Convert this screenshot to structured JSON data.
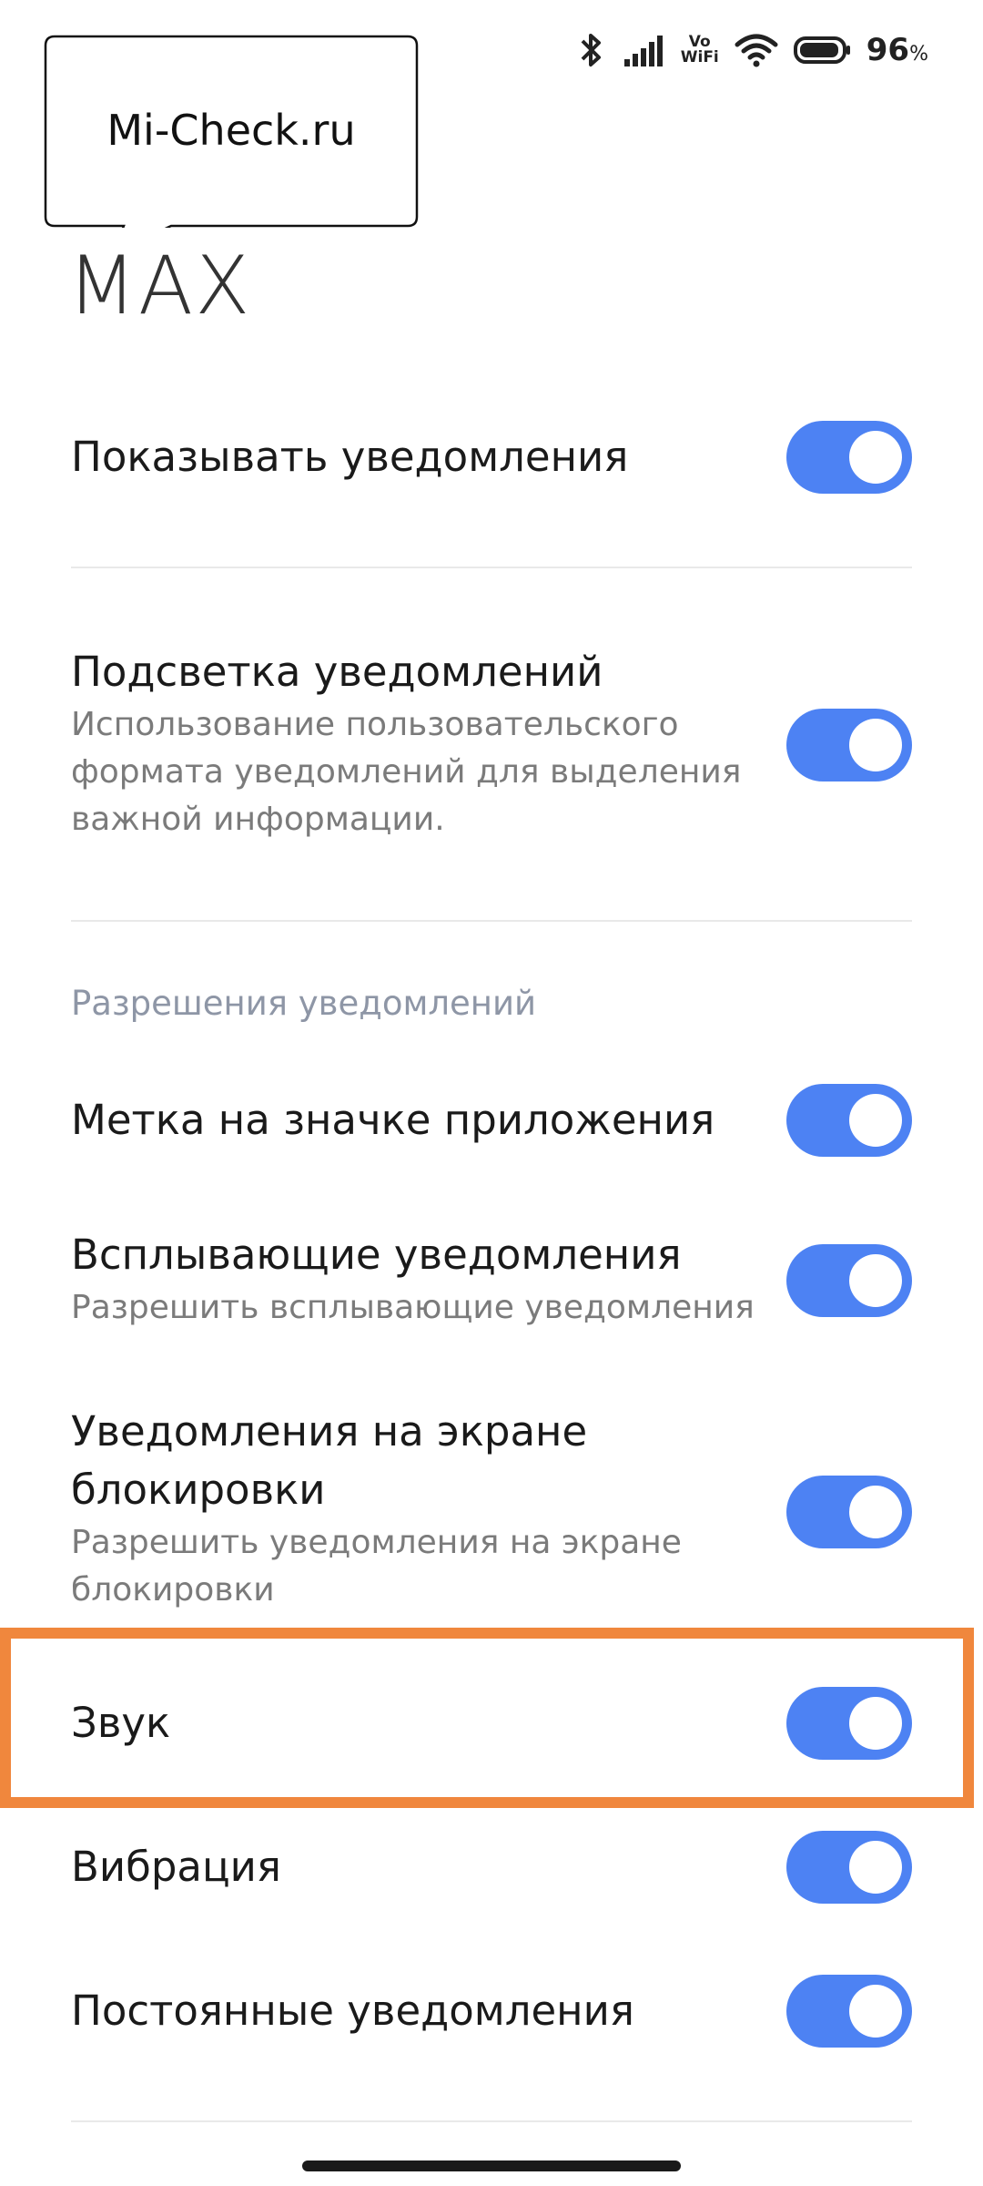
{
  "status_bar": {
    "vowifi_top": "Vo",
    "vowifi_bottom": "WiFi",
    "battery_percent": "96",
    "battery_unit": "%",
    "battery_level": 0.96
  },
  "watermark": {
    "text": "Mi-Check.ru"
  },
  "app": {
    "title": "MAX"
  },
  "settings": {
    "show_notifications": {
      "title": "Показывать уведомления",
      "enabled": true
    },
    "notification_highlight": {
      "title": "Подсветка уведомлений",
      "subtitle_lines": [
        "Использование пользовательского",
        "формата уведомлений для выделения",
        "важной информации."
      ],
      "enabled": true
    },
    "section_header": "Разрешения уведомлений",
    "app_icon_badge": {
      "title": "Метка на значке приложения",
      "enabled": true
    },
    "floating_notifications": {
      "title": "Всплывающие уведомления",
      "subtitle": "Разрешить всплывающие уведомления",
      "enabled": true
    },
    "lock_screen_notifications": {
      "title_lines": [
        "Уведомления на экране",
        "блокировки"
      ],
      "subtitle_lines": [
        "Разрешить уведомления на экране",
        "блокировки"
      ],
      "enabled": true
    },
    "sound": {
      "title": "Звук",
      "enabled": true
    },
    "vibration": {
      "title": "Вибрация",
      "enabled": true
    },
    "persistent_notifications": {
      "title": "Постоянные уведомления",
      "enabled": true
    }
  },
  "colors": {
    "toggle_on": "#4d82f3",
    "highlight_frame": "#f0873d",
    "section_header": "#8e96a6"
  }
}
